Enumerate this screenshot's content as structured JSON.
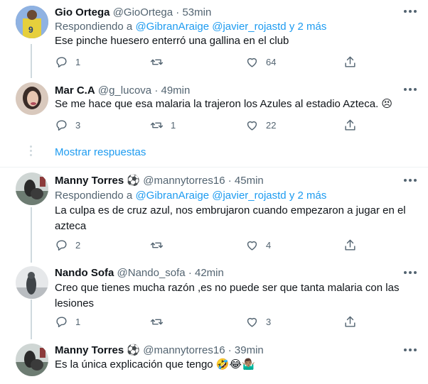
{
  "tweets": [
    {
      "name": "Gio Ortega",
      "handle": "@GioOrtega",
      "time": "53min",
      "replying_prefix": "Respondiendo a",
      "replying_links": "@GibranAraige @javier_rojastd y 2 más",
      "text": "Ese pinche huesero enterró una gallina en el club",
      "replies": "1",
      "retweets": "",
      "likes": "64"
    },
    {
      "name": "Mar C.A",
      "handle": "@g_lucova",
      "time": "49min",
      "text": "Se me hace que esa malaria la trajeron los Azules al estadio Azteca. 😣",
      "replies": "3",
      "retweets": "1",
      "likes": "22"
    },
    {
      "name": "Manny Torres ⚽",
      "handle": "@mannytorres16",
      "time": "45min",
      "replying_prefix": "Respondiendo a",
      "replying_links": "@GibranAraige @javier_rojastd y 2 más",
      "text": "La culpa es de cruz azul, nos embrujaron cuando empezaron a jugar en el azteca",
      "replies": "2",
      "retweets": "",
      "likes": "4"
    },
    {
      "name": "Nando Sofa",
      "handle": "@Nando_sofa",
      "time": "42min",
      "text": "Creo que tienes mucha razón ,es no puede ser que tanta malaria con las lesiones",
      "replies": "1",
      "retweets": "",
      "likes": "3"
    },
    {
      "name": "Manny Torres ⚽",
      "handle": "@mannytorres16",
      "time": "39min",
      "text": "Es la única explicación que tengo 🤣😂🤷🏽‍♂️"
    }
  ],
  "show_replies": "Mostrar respuestas",
  "separator": "·",
  "colors": {
    "accent": "#1d9bf0",
    "muted": "#536471",
    "divider": "#eff3f4"
  },
  "icons": [
    "reply-icon",
    "retweet-icon",
    "like-icon",
    "share-icon",
    "more-icon"
  ]
}
